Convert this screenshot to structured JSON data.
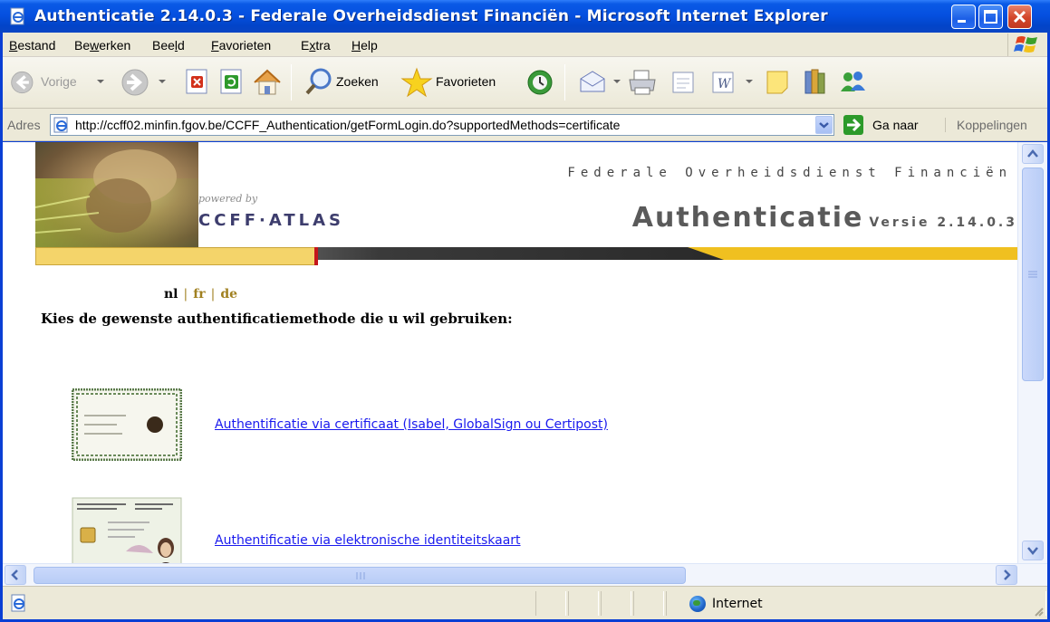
{
  "window": {
    "title": "Authenticatie 2.14.0.3 - Federale Overheidsdienst Financiën - Microsoft Internet Explorer"
  },
  "menu": [
    {
      "label": "Bestand",
      "key": "B",
      "rest": "estand"
    },
    {
      "label": "Bewerken",
      "pre": "Be",
      "key": "w",
      "rest": "erken"
    },
    {
      "label": "Beeld",
      "pre": "Bee",
      "key": "l",
      "rest": "d"
    },
    {
      "label": "Favorieten",
      "key": "F",
      "rest": "avorieten"
    },
    {
      "label": "Extra",
      "pre": "E",
      "key": "x",
      "rest": "tra"
    },
    {
      "label": "Help",
      "key": "H",
      "rest": "elp"
    }
  ],
  "toolbar": {
    "back_label": "Vorige",
    "search_label": "Zoeken",
    "favorites_label": "Favorieten"
  },
  "address": {
    "label": "Adres",
    "url": "http://ccff02.minfin.fgov.be/CCFF_Authentication/getFormLogin.do?supportedMethods=certificate",
    "go_label": "Ga naar",
    "links_label": "Koppelingen"
  },
  "page": {
    "powered_by": "powered by",
    "brand": "CCFF·ATLAS",
    "agency": "Federale Overheidsdienst Financiën",
    "app_title": "Authenticatie",
    "version": "Versie 2.14.0.3",
    "languages": {
      "current": "nl",
      "fr": "fr",
      "de": "de",
      "sep": "|"
    },
    "heading": "Kies de gewenste authentificatiemethode die u wil gebruiken:",
    "methods": [
      {
        "label": "Authentificatie via certificaat (Isabel, GlobalSign ou Certipost)",
        "thumb": "certificate-image"
      },
      {
        "label": "Authentificatie via elektronische identiteitskaart",
        "thumb": "eid-card-image"
      }
    ]
  },
  "status": {
    "zone": "Internet"
  },
  "colors": {
    "titlebar": "#0550e0",
    "chrome": "#ece9d8",
    "link": "#1a1aee",
    "banner_yellow": "#f4d46a",
    "close_button": "#d2452a"
  }
}
